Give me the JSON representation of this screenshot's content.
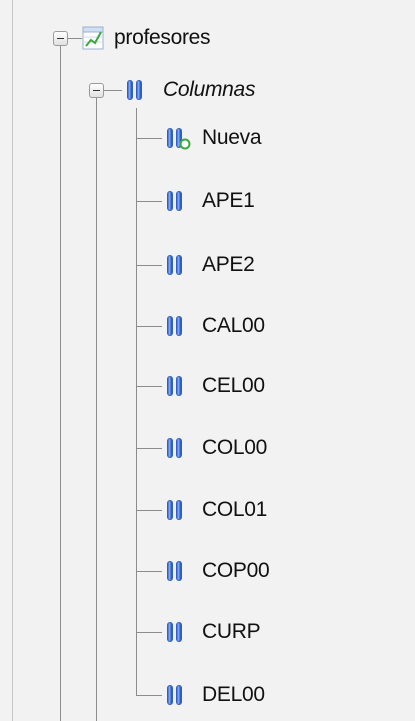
{
  "tree": {
    "table": {
      "label": "profesores",
      "icon": "table-structure-icon",
      "expanded": true
    },
    "columns_group": {
      "label": "Columnas",
      "icon": "columns-icon",
      "expanded": true
    },
    "new_column": {
      "label": "Nueva",
      "icon": "new-column-icon"
    },
    "columns": [
      {
        "label": "APE1",
        "icon": "column-icon"
      },
      {
        "label": "APE2",
        "icon": "column-icon"
      },
      {
        "label": "CAL00",
        "icon": "column-icon"
      },
      {
        "label": "CEL00",
        "icon": "column-icon"
      },
      {
        "label": "COL00",
        "icon": "column-icon"
      },
      {
        "label": "COL01",
        "icon": "column-icon"
      },
      {
        "label": "COP00",
        "icon": "column-icon"
      },
      {
        "label": "CURP",
        "icon": "column-icon"
      },
      {
        "label": "DEL00",
        "icon": "column-icon"
      }
    ]
  },
  "colors": {
    "column_icon": "#2f5fc4",
    "column_icon_light": "#7fa4ee",
    "new_badge": "#3aa83a",
    "tree_lines": "#8c8c8c",
    "panel_background": "#f2f2f2"
  }
}
